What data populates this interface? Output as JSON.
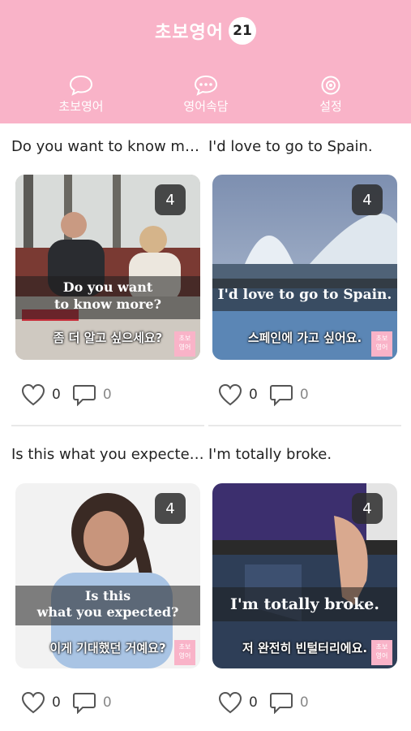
{
  "header": {
    "title": "초보영어",
    "badge": "21",
    "tabs": [
      {
        "label": "초보영어",
        "icon": "chat-bubble-icon"
      },
      {
        "label": "영어속담",
        "icon": "chat-dots-icon"
      },
      {
        "label": "설정",
        "icon": "gear-icon"
      }
    ],
    "colors": {
      "accent": "#f9b3c8"
    }
  },
  "cards": [
    {
      "caption": "Do you want to know mor...",
      "count": "4",
      "english": "Do you want\nto know more?",
      "korean": "좀 더 알고 싶으세요?",
      "brand": "초보\n영어",
      "likes": "0",
      "comments": "0"
    },
    {
      "caption": "I'd love to go to Spain.",
      "count": "4",
      "english": "I'd love to go to Spain.",
      "korean": "스페인에 가고 싶어요.",
      "brand": "초보\n영어",
      "likes": "0",
      "comments": "0"
    },
    {
      "caption": "Is this what you expected?",
      "count": "4",
      "english": "Is this\nwhat you expected?",
      "korean": "이게 기대했던 거예요?",
      "brand": "초보\n영어",
      "likes": "0",
      "comments": "0"
    },
    {
      "caption": "I'm totally broke.",
      "count": "4",
      "english": "I'm totally broke.",
      "korean": "저 완전히 빈털터리에요.",
      "brand": "초보\n영어",
      "likes": "0",
      "comments": "0"
    }
  ]
}
